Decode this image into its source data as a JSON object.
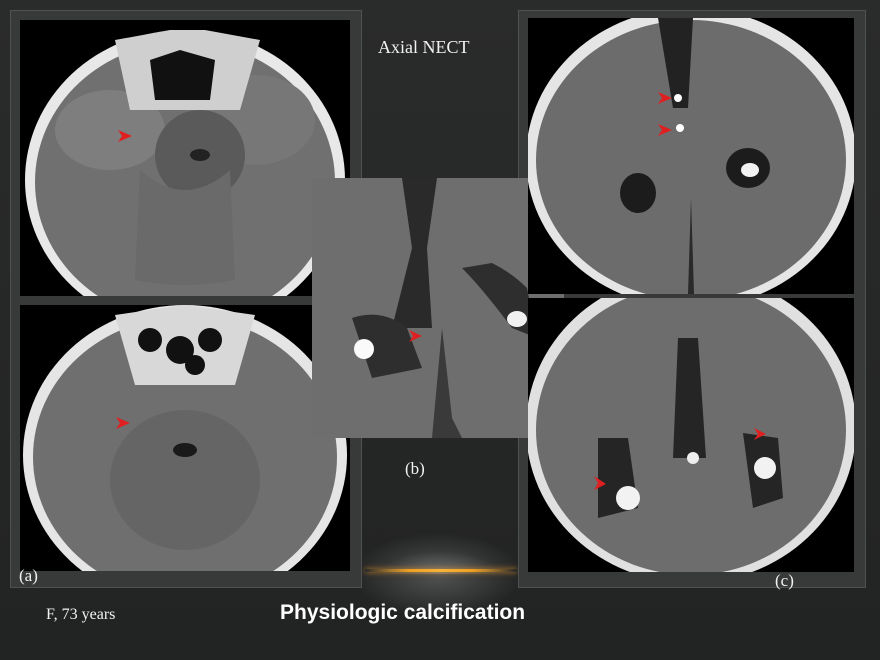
{
  "slide": {
    "modality_title": "Axial NECT",
    "panel_labels": {
      "a": "(a)",
      "b": "(b)",
      "c": "(c)"
    },
    "patient": "F, 73 years",
    "title": "Physiologic calcification"
  },
  "colors": {
    "background": "#262727",
    "panel_frame": "#383a39",
    "arrow": "#e02020",
    "accent_glow": "#f0a020",
    "text": "#f2f2f2"
  },
  "images": [
    {
      "id": "a-top",
      "depicts": "axial CT at skull base with red arrow"
    },
    {
      "id": "a-bottom",
      "depicts": "axial CT at skull base with red arrow"
    },
    {
      "id": "b",
      "depicts": "magnified axial CT with red arrow"
    },
    {
      "id": "c-top",
      "depicts": "axial CT at level of lateral ventricles with two red arrows"
    },
    {
      "id": "c-bottom",
      "depicts": "axial CT at level of lateral ventricles with two red arrows"
    }
  ]
}
